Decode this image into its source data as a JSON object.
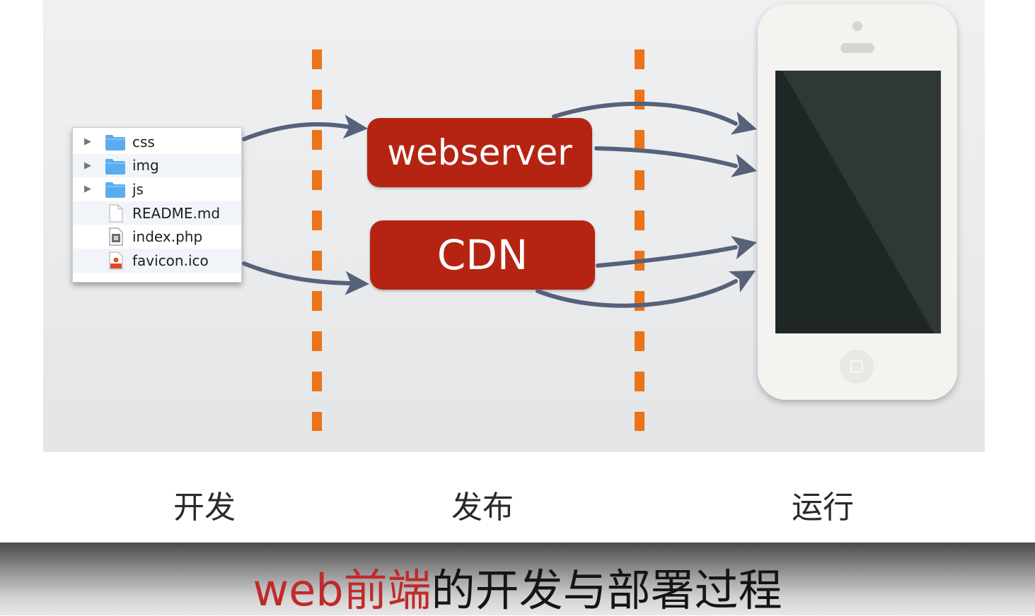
{
  "finder": {
    "items": [
      {
        "label": "css",
        "kind": "folder",
        "icon": "folder-icon",
        "expandable": true
      },
      {
        "label": "img",
        "kind": "folder",
        "icon": "folder-icon",
        "expandable": true
      },
      {
        "label": "js",
        "kind": "folder",
        "icon": "folder-icon",
        "expandable": true
      },
      {
        "label": "README.md",
        "kind": "file",
        "icon": "document-icon",
        "expandable": false
      },
      {
        "label": "index.php",
        "kind": "file",
        "icon": "php-file-icon",
        "expandable": false
      },
      {
        "label": "favicon.ico",
        "kind": "file",
        "icon": "image-file-icon",
        "expandable": false
      }
    ]
  },
  "nodes": {
    "webserver": "webserver",
    "cdn": "CDN"
  },
  "stages": {
    "develop": "开发",
    "publish": "发布",
    "run": "运行"
  },
  "subtitle": {
    "highlight": "web前端",
    "rest": "的开发与部署过程"
  },
  "colors": {
    "node_fill": "#b52412",
    "divider": "#ec7318",
    "arrow": "#56617a",
    "folder": "#5aacef",
    "subtitle_highlight": "#c12a2a"
  }
}
